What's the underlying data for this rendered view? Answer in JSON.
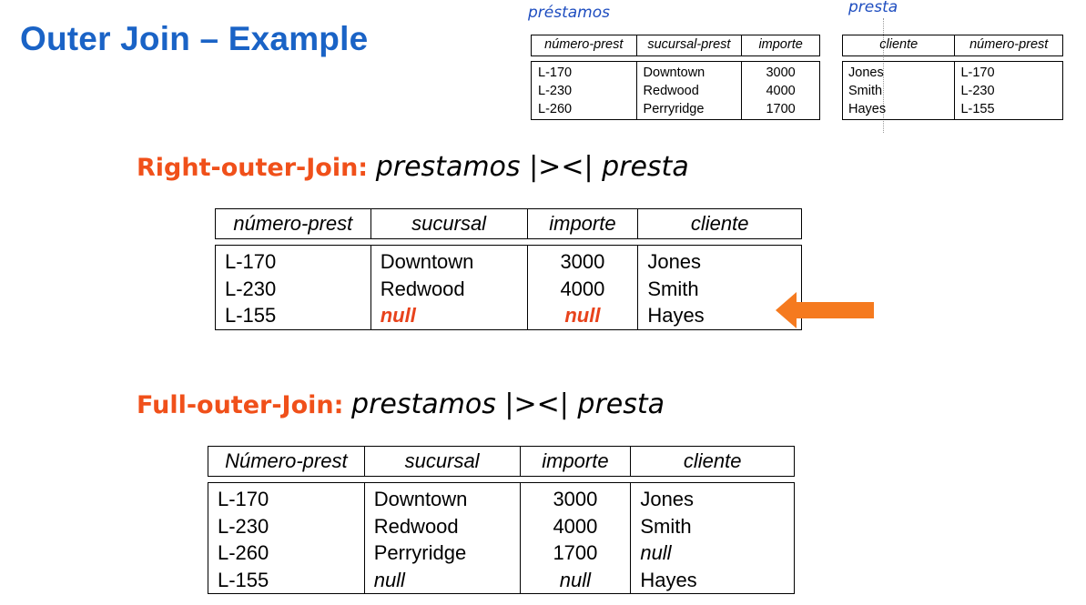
{
  "title": "Outer Join – Example",
  "prestamos_table": {
    "label": "préstamos",
    "headers": [
      "número-prest",
      "sucursal-prest",
      "importe"
    ],
    "rows": [
      [
        "L-170",
        "Downtown",
        "3000"
      ],
      [
        "L-230",
        "Redwood",
        "4000"
      ],
      [
        "L-260",
        "Perryridge",
        "1700"
      ]
    ]
  },
  "presta_table": {
    "label": "presta",
    "headers": [
      "cliente",
      "número-prest"
    ],
    "rows": [
      [
        "Jones",
        "L-170"
      ],
      [
        "Smith",
        "L-230"
      ],
      [
        "Hayes",
        "L-155"
      ]
    ]
  },
  "right_outer": {
    "heading_kw": "Right-outer-Join:",
    "heading_expr": "prestamos |><| presta",
    "headers": [
      "número-prest",
      "sucursal",
      "importe",
      "cliente"
    ],
    "rows": [
      [
        "L-170",
        "Downtown",
        "3000",
        "Jones"
      ],
      [
        "L-230",
        "Redwood",
        "4000",
        "Smith"
      ],
      [
        "L-155",
        "null",
        "null",
        "Hayes"
      ]
    ]
  },
  "full_outer": {
    "heading_kw": "Full-outer-Join:",
    "heading_expr": "prestamos |><| presta",
    "headers": [
      "Número-prest",
      "sucursal",
      "importe",
      "cliente"
    ],
    "rows": [
      [
        "L-170",
        "Downtown",
        "3000",
        "Jones"
      ],
      [
        "L-230",
        "Redwood",
        "4000",
        "Smith"
      ],
      [
        "L-260",
        "Perryridge",
        "1700",
        "null"
      ],
      [
        "L-155",
        "null",
        "null",
        "Hayes"
      ]
    ]
  },
  "colors": {
    "title_blue": "#1a63c6",
    "label_blue": "#1f4ec0",
    "accent_orange": "#f0501a",
    "arrow_orange": "#f57a1f"
  },
  "icons": {
    "arrow": "left-arrow-icon"
  }
}
